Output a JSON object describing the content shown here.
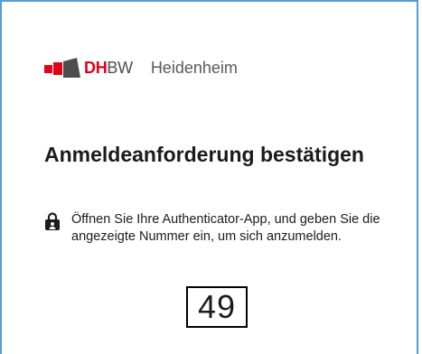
{
  "brand": {
    "name_bold": "DH",
    "name_regular": "BW",
    "location": "Heidenheim",
    "accent_color": "#e2001a",
    "logo_icon": "dhbw-logo-icon"
  },
  "page": {
    "title": "Anmeldeanforderung bestätigen",
    "instruction": "Öffnen Sie Ihre Authenticator-App, und geben Sie die angezeigte Nummer ein, um sich anzumelden.",
    "instruction_icon": "lock-icon",
    "number": "49"
  },
  "colors": {
    "frame_border": "#5b9bd5",
    "text": "#1b1b1b"
  }
}
